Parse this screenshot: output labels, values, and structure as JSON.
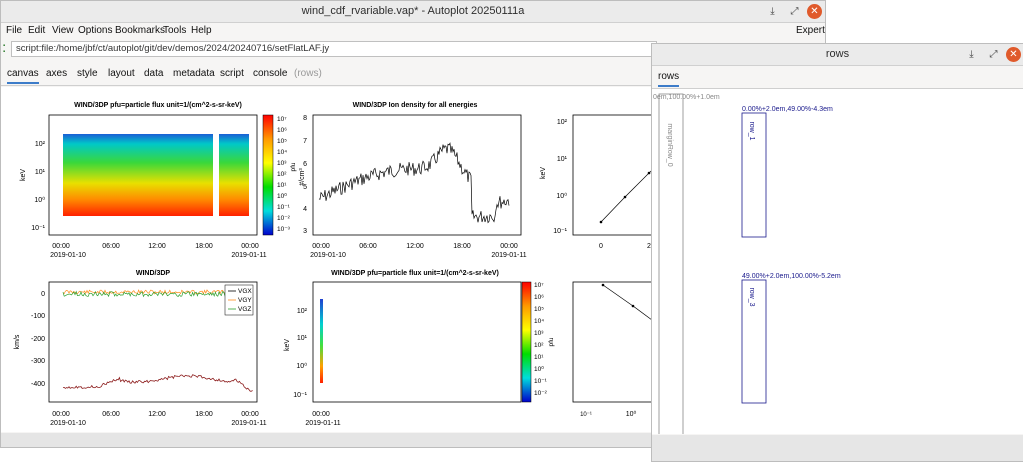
{
  "window": {
    "title": "wind_cdf_rvariable.vap* - Autoplot 20250111a",
    "minimize_glyph": "⤓",
    "maximize_glyph": "⤢",
    "close_glyph": "✕"
  },
  "menu": {
    "items": [
      "File",
      "Edit",
      "View",
      "Options",
      "Bookmarks",
      "Tools",
      "Help"
    ],
    "expert": "Expert"
  },
  "address": {
    "value": "script:file:/home/jbf/ct/autoplot/git/dev/demos/2024/20240716/setFlatLAF.jy"
  },
  "tabs": [
    {
      "label": "canvas",
      "state": "active"
    },
    {
      "label": "axes",
      "state": "normal"
    },
    {
      "label": "style",
      "state": "normal"
    },
    {
      "label": "layout",
      "state": "normal"
    },
    {
      "label": "data",
      "state": "normal"
    },
    {
      "label": "metadata",
      "state": "normal"
    },
    {
      "label": "script",
      "state": "normal"
    },
    {
      "label": "console",
      "state": "normal"
    },
    {
      "label": "(rows)",
      "state": "disabled"
    }
  ],
  "plots": {
    "p1": {
      "title": "WIND/3DP pfu=particle flux unit=1/(cm^2-s-sr-keV)",
      "ylabel": "keV",
      "yticks": [
        "10²",
        "10¹",
        "10⁰",
        "10⁻¹"
      ],
      "xticks": [
        "00:00",
        "06:00",
        "12:00",
        "18:00",
        "00:00"
      ],
      "xdates": [
        "2019-01-10",
        "2019-01-11"
      ],
      "cbticks": [
        "10⁷",
        "10⁶",
        "10⁵",
        "10⁴",
        "10³",
        "10²",
        "10¹",
        "10⁰",
        "10⁻¹",
        "10⁻²",
        "10⁻³"
      ],
      "cblabel": "pfu"
    },
    "p2": {
      "title": "WIND/3DP Ion density for all energies",
      "ylabel": "#/cm³",
      "yticks": [
        "8",
        "7",
        "6",
        "5",
        "4",
        "3"
      ],
      "xticks": [
        "00:00",
        "06:00",
        "12:00",
        "18:00",
        "00:00"
      ],
      "xdates": [
        "2019-01-10",
        "2019-01-11"
      ]
    },
    "p3": {
      "ylabel": "keV",
      "yticks": [
        "10²",
        "10¹",
        "10⁰",
        "10⁻¹"
      ],
      "xticks": [
        "0",
        "2"
      ]
    },
    "p4": {
      "title": "WIND/3DP",
      "ylabel": "km/s",
      "yticks": [
        "0",
        "-100",
        "-200",
        "-300",
        "-400"
      ],
      "xticks": [
        "00:00",
        "06:00",
        "12:00",
        "18:00",
        "00:00"
      ],
      "xdates": [
        "2019-01-10",
        "2019-01-11"
      ],
      "legend": [
        "VGX",
        "VGY",
        "VGZ"
      ]
    },
    "p5": {
      "title": "WIND/3DP pfu=particle flux unit=1/(cm^2-s-sr-keV)",
      "ylabel": "keV",
      "yticks": [
        "10²",
        "10¹",
        "10⁰",
        "10⁻¹"
      ],
      "xticks": [
        "00:00"
      ],
      "xdates": [
        "2019-01-11"
      ],
      "cbticks": [
        "10⁷",
        "10⁶",
        "10⁵",
        "10⁴",
        "10³",
        "10²",
        "10¹",
        "10⁰",
        "10⁻¹",
        "10⁻²"
      ],
      "cblabel": "pfu"
    },
    "p6": {
      "yticks": [
        "10⁷",
        "10⁶",
        "10⁵",
        "10⁴",
        "10³",
        "10²",
        "10¹",
        "10⁰",
        "10⁻¹",
        "10⁻²"
      ],
      "xticks": [
        "10⁰"
      ]
    }
  },
  "colors": {
    "accent": "#3d7cc9",
    "close": "#e05a2b",
    "series_x": "#ff8c1a",
    "series_y": "#2ca02c",
    "series_main": "#8b1a1a",
    "layout_blue": "#1a1a8c"
  },
  "rows_window": {
    "title": "rows",
    "tab": "rows",
    "margin_label": "0em,100.00%+1.0em",
    "margin_rect_label": "marginRow_0",
    "row1_label": "0.00%+2.0em,49.00%-4.3em",
    "row1_rect_label": "row_1",
    "row3_label": "49.00%+2.0em,100.00%-5.2em",
    "row3_rect_label": "row_3"
  }
}
